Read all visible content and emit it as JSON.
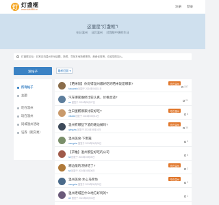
{
  "header": {
    "logo_mark": "灯",
    "logo_title": "灯盏框",
    "logo_url": "www.dzk888.cn",
    "links": [
      "注册",
      "登录"
    ]
  },
  "hero": {
    "title": "这里是\"灯盏框\"!",
    "subtitle": [
      "在日温州",
      "日后温州",
      "对我眼中想的生日"
    ]
  },
  "notice": {
    "text": "灯盏框论坛：日常交流温州本地话题、新闻、寻找本地新鲜事物、美食优惠等，欢迎您的加入。"
  },
  "sidebar": {
    "post_button": "发帖子",
    "items": [
      {
        "label": "所有帖子",
        "active": true
      },
      {
        "label": "主题",
        "active": false
      },
      {
        "label": "吃在温州",
        "active": false
      },
      {
        "label": "玩在温州",
        "active": false
      },
      {
        "label": "同城温州活动",
        "active": false
      },
      {
        "label": "证券（期交易）",
        "active": false
      }
    ]
  },
  "filter": {
    "label": "最新回复 ▾"
  },
  "posts": [
    {
      "title": "【晒米饭】你觉得温州最好吃的晒米饭是哪家?",
      "user": "fuxuanxin",
      "meta": "回复于 2024年06月11日",
      "badge": "吃在温州",
      "count": "157",
      "avatar_color": "#8a6d4b"
    },
    {
      "title": "汽车哪家维修比较认真，价格合适?",
      "user": "wz",
      "meta": "回复于 2024年05月07日",
      "badge": "",
      "count": "21",
      "avatar_color": "#5d7e9c"
    },
    {
      "title": "生日蛋糕哪家比较好吃?",
      "user": "ufsada",
      "meta": "回复于 2024年06月11日",
      "badge": "吃在温州",
      "count": "8",
      "avatar_color": "#c99a6b"
    },
    {
      "title": "温州有哪些下酒的路边摊吗?",
      "user": "qhngzhu",
      "meta": "回复于 2024年05月10日",
      "badge": "吃在温州",
      "count": "30",
      "avatar_color": "#3d4a5a"
    },
    {
      "title": "温州美食·下雨篇",
      "user": "mengshe",
      "meta": "回复于 2024年05月05日",
      "badge": "",
      "count": "5",
      "avatar_color": "#7a8f6a"
    },
    {
      "title": "【求推】温州那些好吃的公司",
      "user": "sd",
      "meta": "回复于 2024年05月05日",
      "badge": "",
      "count": "6",
      "avatar_color": "#a05a4a"
    },
    {
      "title": "哪边能的汤好吃了?",
      "user": "sd",
      "meta": "回复于 2024年05月06日",
      "badge": "吃在温州",
      "count": "2",
      "avatar_color": "#b07a3a"
    },
    {
      "title": "温州美食·水心马蹄坊",
      "user": "mengshe",
      "meta": "回复于 2024年05月03日",
      "badge": "吃在温州",
      "count": "3",
      "avatar_color": "#4a6a8a"
    },
    {
      "title": "温州老城区什么地方好玩的?",
      "user": "wz",
      "meta": "回复于 2024年05月03日",
      "badge": "",
      "count": "1",
      "avatar_color": "#6a5a7a"
    }
  ],
  "colors": {
    "accent": "#3b82c4",
    "badge": "#e0762a",
    "hero_bg": "#cfe0ee"
  }
}
